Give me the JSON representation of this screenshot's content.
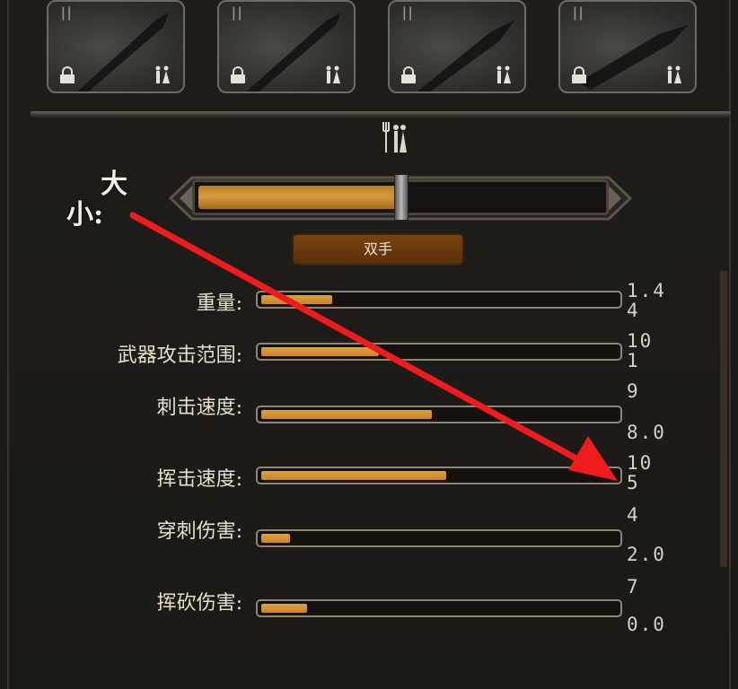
{
  "cards": [
    {
      "tick": "ǀǀ",
      "lock_icon": "lock-icon",
      "people_icon": "people-icon"
    },
    {
      "tick": "ǀǀ",
      "lock_icon": "lock-icon",
      "people_icon": "people-icon"
    },
    {
      "tick": "ǀǀ",
      "lock_icon": "lock-icon",
      "people_icon": "people-icon"
    },
    {
      "tick": "ǀǀ",
      "lock_icon": "lock-icon",
      "people_icon": "people-icon"
    }
  ],
  "header_icon": "people-icon",
  "size": {
    "label_big": "大",
    "label_small": "小:",
    "level": 0.5
  },
  "mode_button": "双手",
  "stats": [
    {
      "label": "重量:",
      "fill": 0.2,
      "top_value": "1.4",
      "bottom_value": "4"
    },
    {
      "label": "武器攻击范围:",
      "fill": 0.33,
      "top_value": "10",
      "bottom_value": "1"
    },
    {
      "label": "刺击速度:",
      "fill": 0.48,
      "top_value": "9",
      "bottom_value": "8.0"
    },
    {
      "label": "挥击速度:",
      "fill": 0.52,
      "top_value": "10",
      "bottom_value": "5"
    },
    {
      "label": "穿刺伤害:",
      "fill": 0.08,
      "top_value": "4",
      "bottom_value": "2.0"
    },
    {
      "label": "挥砍伤害:",
      "fill": 0.13,
      "top_value": "7",
      "bottom_value": "0.0"
    }
  ],
  "colors": {
    "annotation_arrow": "#ee1c1c",
    "bar_fill": "#d7962f"
  }
}
